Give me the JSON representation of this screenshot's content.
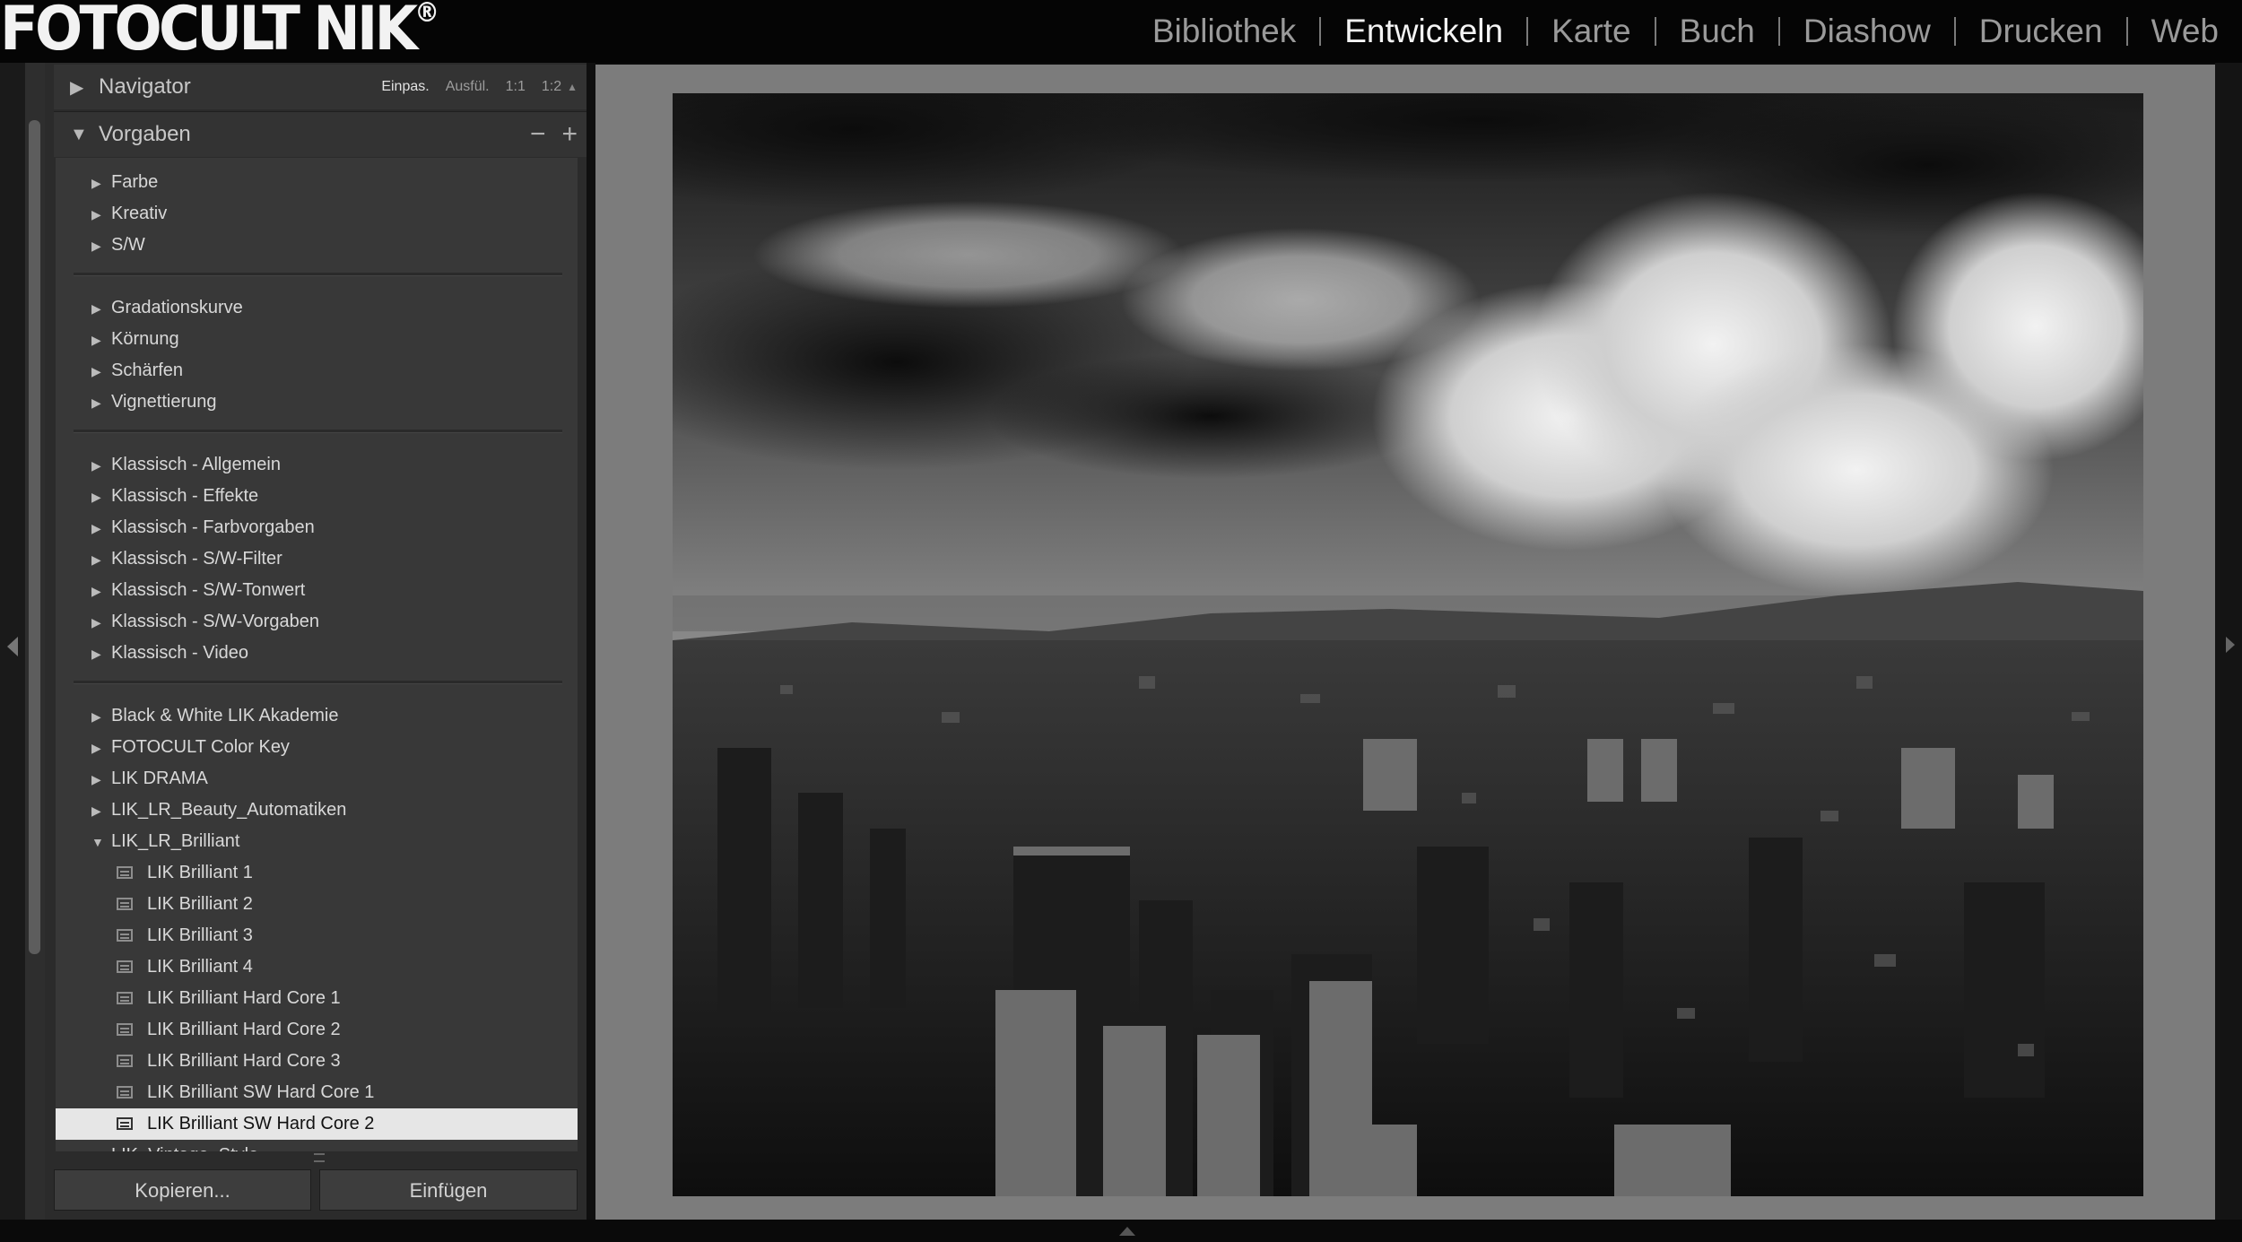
{
  "brand": {
    "logo_text": "FOTOCULT",
    "logo_text2": "NIK",
    "logo_reg": "®"
  },
  "modules": [
    {
      "label": "Bibliothek",
      "active": false
    },
    {
      "label": "Entwickeln",
      "active": true
    },
    {
      "label": "Karte",
      "active": false
    },
    {
      "label": "Buch",
      "active": false
    },
    {
      "label": "Diashow",
      "active": false
    },
    {
      "label": "Drucken",
      "active": false
    },
    {
      "label": "Web",
      "active": false
    }
  ],
  "navigator": {
    "title": "Navigator",
    "zoom_fit": "Einpas.",
    "zoom_fill": "Ausfül.",
    "zoom_1_1": "1:1",
    "zoom_1_2": "1:2"
  },
  "presets": {
    "title": "Vorgaben",
    "minus": "−",
    "plus": "+",
    "groups": [
      [
        "Farbe",
        "Kreativ",
        "S/W"
      ],
      [
        "Gradationskurve",
        "Körnung",
        "Schärfen",
        "Vignettierung"
      ],
      [
        "Klassisch - Allgemein",
        "Klassisch - Effekte",
        "Klassisch - Farbvorgaben",
        "Klassisch - S/W-Filter",
        "Klassisch - S/W-Tonwert",
        "Klassisch - S/W-Vorgaben",
        "Klassisch - Video"
      ],
      [
        "Black & White LIK Akademie",
        "FOTOCULT Color Key",
        "LIK DRAMA",
        "LIK_LR_Beauty_Automatiken",
        "LIK_LR_Brilliant"
      ]
    ],
    "brilliant_children": [
      "LIK Brilliant 1",
      "LIK Brilliant 2",
      "LIK Brilliant 3",
      "LIK Brilliant 4",
      "LIK Brilliant Hard Core 1",
      "LIK Brilliant Hard Core 2",
      "LIK Brilliant Hard Core 3",
      "LIK Brilliant SW Hard Core 1",
      "LIK Brilliant SW Hard Core 2"
    ],
    "selected": "LIK Brilliant SW Hard Core 2",
    "partial_next": "LIK_Vintage_Style"
  },
  "buttons": {
    "copy": "Kopieren...",
    "paste": "Einfügen"
  },
  "colors": {
    "panel": "#2b2b2b",
    "list": "#383838",
    "selection": "#e6e6e6",
    "canvas": "#7c7c7c"
  }
}
